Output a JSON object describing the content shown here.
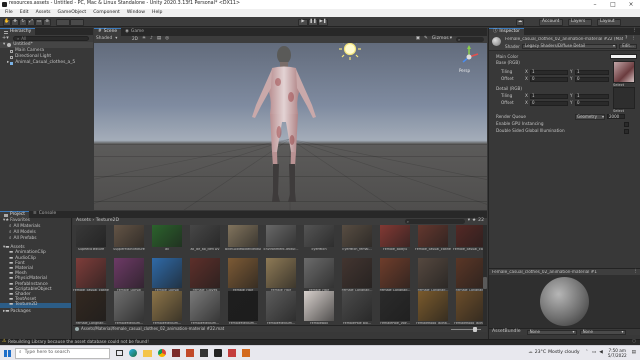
{
  "window": {
    "title": "resources.assets - Untitled - PC, Mac & Linux Standalone - Unity 2020.3.13f1 Personal* <DX11>"
  },
  "menu": [
    "File",
    "Edit",
    "Assets",
    "GameObject",
    "Component",
    "Window",
    "Help"
  ],
  "toolbar": {
    "account": "Account",
    "layers": "Layers",
    "layout": "Layout"
  },
  "hierarchy": {
    "tab": "Hierarchy",
    "search_placeholder": "All",
    "items": [
      "Untitled*",
      "Main Camera",
      "Directional Light",
      "Animal_Casual_clothes_a_5"
    ]
  },
  "scene": {
    "tabs": [
      "Scene",
      "Game"
    ],
    "shading": "Shaded",
    "gizmos": "Gizmos",
    "gizmo_persp": "Persp"
  },
  "project": {
    "tabs": [
      "Project",
      "Console"
    ],
    "breadcrumb": "Assets › Texture2D",
    "tree": [
      "Favorites",
      "All Materials",
      "All Models",
      "All Prefabs",
      "Assets",
      "AnimationClip",
      "AudioClip",
      "Font",
      "Material",
      "Mesh",
      "PhysicMaterial",
      "PrefabInstance",
      "ScriptableObject",
      "Shader",
      "TextAsset",
      "Texture2D",
      "Packages"
    ],
    "path": "Assets/Material/female_casual_clothes_02_animation-material #22.mat",
    "count": "22",
    "row_labels": [
      [
        "SupRecoTexture",
        "SupperMainTexture",
        "all",
        "all_dif_ao_diffTDV",
        "BikeGoldMoldedTexture",
        "Environment-Textur...",
        "EyePatch",
        "EyePatch_femal...",
        "Female_Body4",
        "Female_casual_clothe...",
        "Female_casual_clothe..."
      ],
      [
        "Female_casual_clothe...",
        "Female_Dorsal",
        "Female_Dorsal",
        "Female_Gloves",
        "Female_Hair",
        "Female_Hair",
        "Female_Hair",
        "Female_Longhair...",
        "Female_Longhair...",
        "Female_Longhair...",
        "Female_Longhair..."
      ],
      [
        "Female_Longhair...",
        "FemaleMedium...",
        "FemaleMedium...",
        "FemaleMedium...",
        "FemaleMedium...",
        "FemaleMedium...",
        "FemaleBox",
        "FemalePale Blo...",
        "FemalePale_Voir...",
        "FemaleRooo Tailha...",
        "FemaleRooo Tailha..."
      ]
    ]
  },
  "inspector": {
    "tab": "Inspector",
    "title": "Female_casual_clothes_02_animation-material #22 (Mat",
    "shader_label": "Shader",
    "shader_value": "Legacy Shaders/Diffuse Detail",
    "edit_label": "Edit...",
    "main_color": "Main Color",
    "base_rgb": "Base (RGB)",
    "tiling": "Tiling",
    "offset": "Offset",
    "x": "X",
    "y": "Y",
    "tiling_main_x": "1",
    "tiling_main_y": "1",
    "offset_main_x": "0",
    "offset_main_y": "0",
    "detail_rgb": "Detail (RGB)",
    "tiling_detail_x": "1",
    "tiling_detail_y": "1",
    "offset_detail_x": "0",
    "offset_detail_y": "0",
    "select": "Select",
    "render_queue": "Render Queue",
    "render_queue_mode": "Geometry",
    "render_queue_value": "2000",
    "gpu_instancing": "Enable GPU Instancing",
    "double_sided": "Double Sided Global Illumination",
    "preview_name": "Female_casual_clothes_02_animation-material #1",
    "assetbundle_label": "AssetBundle",
    "assetbundle_value": "None",
    "assetbundle_variant": "None"
  },
  "status": {
    "message": "Rebuilding Library because the asset database could not be found!"
  },
  "taskbar": {
    "search_placeholder": "Type here to search",
    "weather_temp": "23°C",
    "weather_desc": "Mostly cloudy",
    "time": "7:50 am",
    "date": "5/7/2022"
  },
  "colors": {
    "accent": "#3a79bb",
    "panel": "#383838",
    "selected": "#2c5d87",
    "taskbar": "#e8e8ee"
  }
}
